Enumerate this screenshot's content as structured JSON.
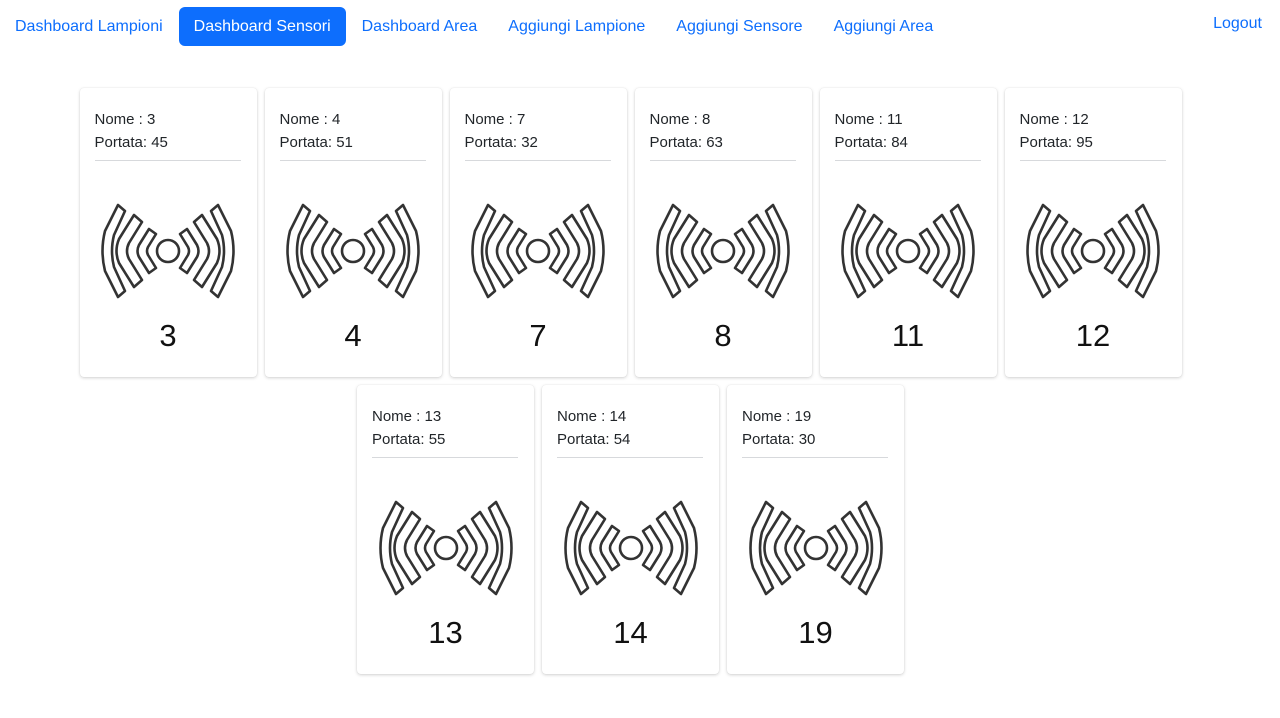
{
  "nav": {
    "links": [
      {
        "label": "Dashboard Lampioni",
        "active": false
      },
      {
        "label": "Dashboard Sensori",
        "active": true
      },
      {
        "label": "Dashboard Area",
        "active": false
      },
      {
        "label": "Aggiungi Lampione",
        "active": false
      },
      {
        "label": "Aggiungi Sensore",
        "active": false
      },
      {
        "label": "Aggiungi Area",
        "active": false
      }
    ],
    "logout_label": "Logout"
  },
  "labels": {
    "nome_prefix": "Nome : ",
    "portata_prefix": "Portata: "
  },
  "sensors": [
    {
      "nome": "3",
      "portata": "45",
      "number": "3"
    },
    {
      "nome": "4",
      "portata": "51",
      "number": "4"
    },
    {
      "nome": "7",
      "portata": "32",
      "number": "7"
    },
    {
      "nome": "8",
      "portata": "63",
      "number": "8"
    },
    {
      "nome": "11",
      "portata": "84",
      "number": "11"
    },
    {
      "nome": "12",
      "portata": "95",
      "number": "12"
    },
    {
      "nome": "13",
      "portata": "55",
      "number": "13"
    },
    {
      "nome": "14",
      "portata": "54",
      "number": "14"
    },
    {
      "nome": "19",
      "portata": "30",
      "number": "19"
    }
  ],
  "icons": {
    "sensor": "wireless-signal-icon"
  },
  "colors": {
    "accent": "#0d6efd",
    "icon_stroke": "#333333"
  }
}
